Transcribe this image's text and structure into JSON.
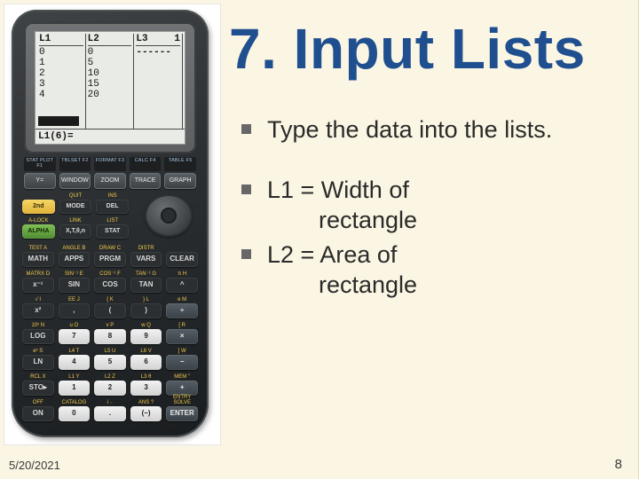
{
  "headline": "7. Input Lists",
  "bullets": [
    {
      "text": "Type the data into the lists."
    },
    {
      "text_a": "L1 = Width of",
      "text_b": "rectangle"
    },
    {
      "text_a": "L2 = Area of",
      "text_b": "rectangle"
    }
  ],
  "footer": {
    "date": "5/20/2021",
    "page": "8"
  },
  "calc": {
    "cols": {
      "L1": {
        "head": "L1",
        "vals": "0\n1\n2\n3\n4"
      },
      "L2": {
        "head": "L2",
        "vals": "0\n5\n10\n15\n20"
      },
      "L3": {
        "head": "L3",
        "corner": "1",
        "vals": "------"
      }
    },
    "entry": "L1(6)=",
    "softlabels": [
      "STAT PLOT F1",
      "TBLSET F2",
      "FORMAT F3",
      "CALC F4",
      "TABLE F5"
    ],
    "fkeys": [
      "Y=",
      "WINDOW",
      "ZOOM",
      "TRACE",
      "GRAPH"
    ],
    "top_rows": [
      [
        {
          "lab": "",
          "t": "2nd",
          "cls": "btn-yellow"
        },
        {
          "lab": "QUIT",
          "t": "MODE",
          "cls": "btn-dark"
        },
        {
          "lab": "INS",
          "t": "DEL",
          "cls": "btn-dark"
        }
      ],
      [
        {
          "lab": "A-LOCK",
          "t": "ALPHA",
          "cls": "btn-green"
        },
        {
          "lab": "LINK",
          "t": "X,T,θ,n",
          "cls": "btn-dark"
        },
        {
          "lab": "LIST",
          "t": "STAT",
          "cls": "btn-dark"
        }
      ]
    ],
    "main_rows": [
      [
        {
          "lab": "TEST A",
          "t": "MATH",
          "cls": "btn-dark"
        },
        {
          "lab": "ANGLE B",
          "t": "APPS",
          "cls": "btn-dark"
        },
        {
          "lab": "DRAW C",
          "t": "PRGM",
          "cls": "btn-dark"
        },
        {
          "lab": "DISTR",
          "t": "VARS",
          "cls": "btn-dark"
        },
        {
          "lab": "",
          "t": "CLEAR",
          "cls": "btn-dark"
        }
      ],
      [
        {
          "lab": "MATRX D",
          "t": "x⁻¹",
          "cls": "btn-dark"
        },
        {
          "lab": "SIN⁻¹ E",
          "t": "SIN",
          "cls": "btn-dark"
        },
        {
          "lab": "COS⁻¹ F",
          "t": "COS",
          "cls": "btn-dark"
        },
        {
          "lab": "TAN⁻¹ G",
          "t": "TAN",
          "cls": "btn-dark"
        },
        {
          "lab": "π H",
          "t": "^",
          "cls": "btn-dark"
        }
      ],
      [
        {
          "lab": "√ I",
          "t": "x²",
          "cls": "btn-dark"
        },
        {
          "lab": "EE J",
          "t": ",",
          "cls": "btn-dark"
        },
        {
          "lab": "{ K",
          "t": "(",
          "cls": "btn-dark"
        },
        {
          "lab": "} L",
          "t": ")",
          "cls": "btn-dark"
        },
        {
          "lab": "e M",
          "t": "÷",
          "cls": "btn-blue"
        }
      ],
      [
        {
          "lab": "10ˣ N",
          "t": "LOG",
          "cls": "btn-dark"
        },
        {
          "lab": "u O",
          "t": "7",
          "cls": "btn-white"
        },
        {
          "lab": "v P",
          "t": "8",
          "cls": "btn-white"
        },
        {
          "lab": "w Q",
          "t": "9",
          "cls": "btn-white"
        },
        {
          "lab": "[ R",
          "t": "×",
          "cls": "btn-blue"
        }
      ],
      [
        {
          "lab": "eˣ S",
          "t": "LN",
          "cls": "btn-dark"
        },
        {
          "lab": "L4 T",
          "t": "4",
          "cls": "btn-white"
        },
        {
          "lab": "L5 U",
          "t": "5",
          "cls": "btn-white"
        },
        {
          "lab": "L6 V",
          "t": "6",
          "cls": "btn-white"
        },
        {
          "lab": "] W",
          "t": "−",
          "cls": "btn-blue"
        }
      ],
      [
        {
          "lab": "RCL X",
          "t": "STO▸",
          "cls": "btn-dark"
        },
        {
          "lab": "L1 Y",
          "t": "1",
          "cls": "btn-white"
        },
        {
          "lab": "L2 Z",
          "t": "2",
          "cls": "btn-white"
        },
        {
          "lab": "L3 θ",
          "t": "3",
          "cls": "btn-white"
        },
        {
          "lab": "MEM \"",
          "t": "+",
          "cls": "btn-blue"
        }
      ],
      [
        {
          "lab": "OFF",
          "t": "ON",
          "cls": "btn-dark"
        },
        {
          "lab": "CATALOG",
          "t": "0",
          "cls": "btn-white"
        },
        {
          "lab": "i ₋",
          "t": ".",
          "cls": "btn-white"
        },
        {
          "lab": "ANS ?",
          "t": "(−)",
          "cls": "btn-white"
        },
        {
          "lab": "ENTRY SOLVE",
          "t": "ENTER",
          "cls": "btn-blue"
        }
      ]
    ]
  }
}
